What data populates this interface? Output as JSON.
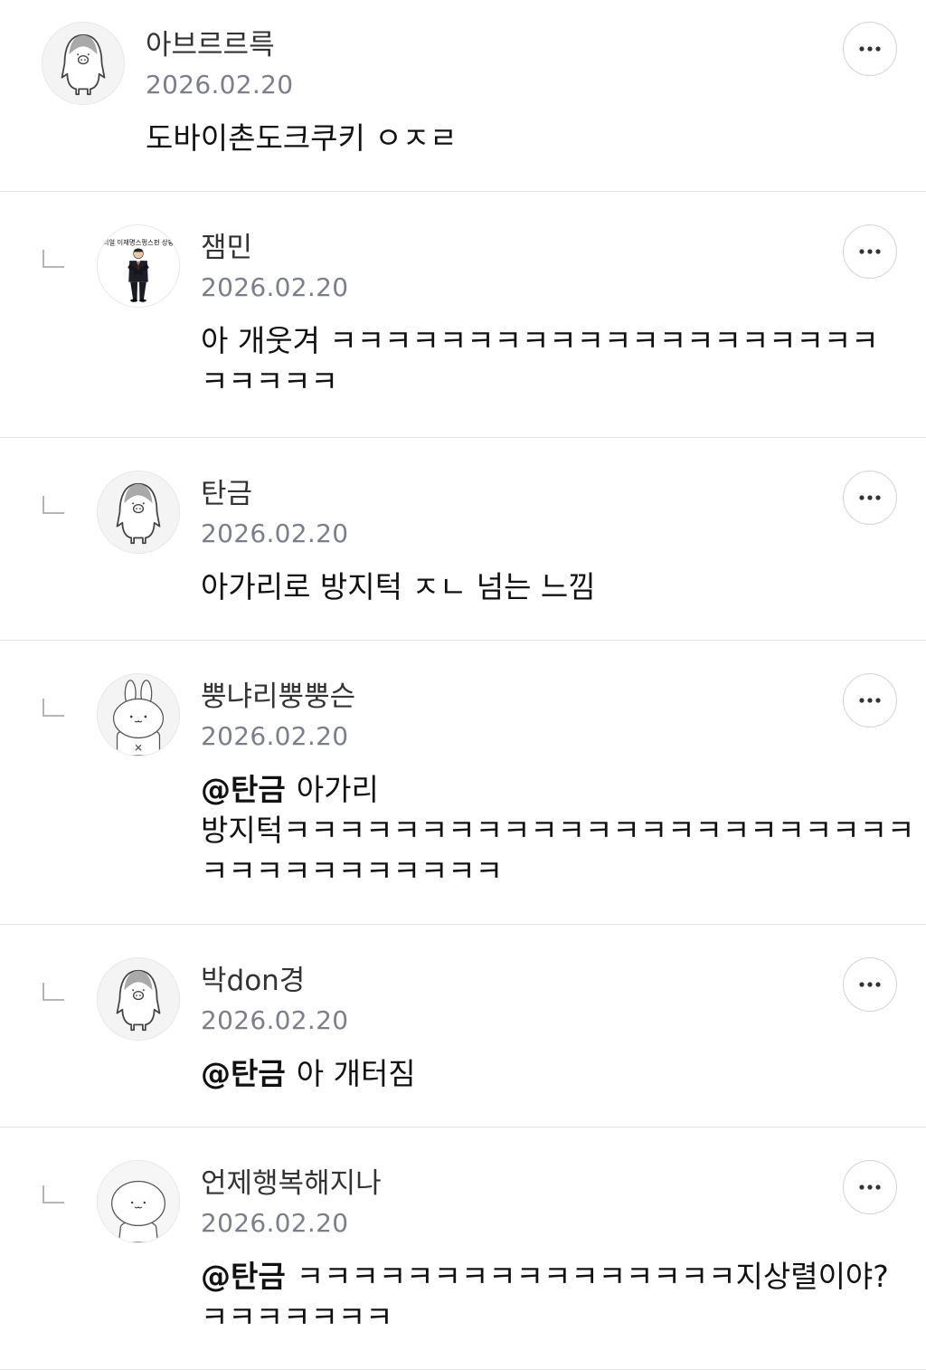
{
  "comments": [
    {
      "nickname": "아브르르륵",
      "date": "2026.02.20",
      "text_lines": [
        "도바이촌도크쿠키 ㅇㅈㄹ"
      ],
      "is_reply": false,
      "avatar_icon": "penguin-icon"
    },
    {
      "nickname": "잼민",
      "date": "2026.02.20",
      "text_lines": [
        "아 개웃겨 ㅋㅋㅋㅋㅋㅋㅋㅋㅋㅋㅋㅋㅋㅋㅋㅋㅋㅋㅋㅋ",
        "ㅋㅋㅋㅋㅋ"
      ],
      "is_reply": true,
      "avatar_icon": "man-in-suit-icon",
      "avatar_caption": "리얼 이재명스펑스펀 상황"
    },
    {
      "nickname": "탄금",
      "date": "2026.02.20",
      "text_lines": [
        "아가리로 방지턱 ㅈㄴ 넘는 느낌"
      ],
      "is_reply": true,
      "avatar_icon": "penguin-icon"
    },
    {
      "nickname": "뿡냐리뿡뿡슨",
      "date": "2026.02.20",
      "mention": "@탄금",
      "text_lines": [
        "아가리",
        "방지턱ㅋㅋㅋㅋㅋㅋㅋㅋㅋㅋㅋㅋㅋㅋㅋㅋㅋㅋㅋㅋㅋㅋㅋ",
        "ㅋㅋㅋㅋㅋㅋㅋㅋㅋㅋㅋ"
      ],
      "is_reply": true,
      "avatar_icon": "rabbit-icon"
    },
    {
      "nickname": "박don경",
      "date": "2026.02.20",
      "mention": "@탄금",
      "text_lines": [
        "아 개터짐"
      ],
      "is_reply": true,
      "avatar_icon": "penguin-icon"
    },
    {
      "nickname": "언제행복해지나",
      "date": "2026.02.20",
      "mention": "@탄금",
      "text_lines": [
        "ㅋㅋㅋㅋㅋㅋㅋㅋㅋㅋㅋㅋㅋㅋㅋㅋ지상렬이야?",
        "ㅋㅋㅋㅋㅋㅋㅋ"
      ],
      "is_reply": true,
      "avatar_icon": "blob-character-icon"
    }
  ],
  "more_button_icon": "ellipsis-icon",
  "colors": {
    "nickname": "#333333",
    "date": "#7c7f8a",
    "text": "#111111",
    "divider": "#e3e3e3"
  }
}
